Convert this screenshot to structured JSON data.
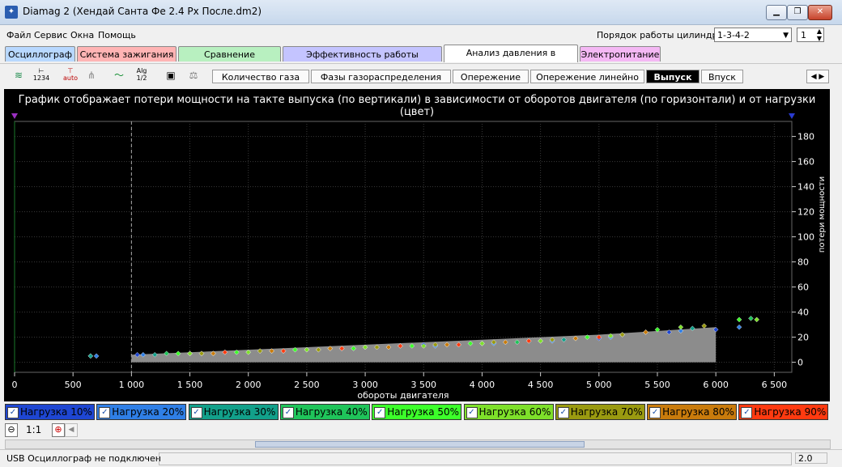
{
  "window": {
    "title": "Diamag 2 (Хендай Санта Фе 2.4 Px После.dm2)",
    "icon": "diamag-app-icon"
  },
  "menu": {
    "items": [
      "Файл",
      "Сервис",
      "Окна",
      "Помощь"
    ]
  },
  "firing_order": {
    "label": "Порядок работы цилиндров",
    "value": "1-3-4-2",
    "cylinder": "1"
  },
  "main_tabs": [
    {
      "label": "Осциллограф",
      "color": "#b8d8ff"
    },
    {
      "label": "Система зажигания",
      "color": "#ffb4b4"
    },
    {
      "label": "Сравнение цилиндров",
      "color": "#b8f0c0"
    },
    {
      "label": "Эффективность работы цилиндров",
      "color": "#c4c4ff"
    },
    {
      "label": "Анализ давления в цилиндре",
      "color": "#ffffff",
      "active": true
    },
    {
      "label": "Электропитание",
      "color": "#f4b8f4"
    }
  ],
  "toolbar": {
    "tools": [
      "waveform-icon",
      "counter-icon",
      "auto-scale-icon",
      "filter-icon",
      "curve-icon",
      "algorithm-icon",
      "save-icon",
      "balance-icon"
    ],
    "alg_top": "Alg",
    "alg_bottom": "1/2",
    "auto": "auto",
    "n1234": "1234"
  },
  "sub_tabs": [
    {
      "label": "Количество газа"
    },
    {
      "label": "Фазы газораспределения"
    },
    {
      "label": "Опережение"
    },
    {
      "label": "Опережение линейно"
    },
    {
      "label": "Выпуск",
      "active": true
    },
    {
      "label": "Впуск"
    }
  ],
  "chart_data": {
    "type": "scatter",
    "title": "График отображает потери мощности на такте выпуска (по вертикали) в зависимости от оборотов двигателя (по горизонтали) и от нагрузки (цвет)",
    "xlabel": "обороты двигателя",
    "ylabel": "потери мощности",
    "xlim": [
      0,
      6650
    ],
    "ylim": [
      -8,
      192
    ],
    "x_ticks": [
      "0",
      "500",
      "1 000",
      "1 500",
      "2 000",
      "2 500",
      "3 000",
      "3 500",
      "4 000",
      "4 500",
      "5 000",
      "5 500",
      "6 000",
      "6 500"
    ],
    "y_ticks": [
      "0",
      "20",
      "40",
      "60",
      "80",
      "100",
      "120",
      "140",
      "160",
      "180"
    ],
    "grid": true,
    "legend_position": "bottom",
    "band": {
      "x": [
        1000,
        5000,
        6000
      ],
      "y_top": [
        6,
        22,
        28
      ],
      "y_bottom": 0
    },
    "series": [
      {
        "name": "Нагрузка 10%",
        "color": "#1e46d2",
        "x": [
          650,
          1050,
          1500,
          2000,
          2500,
          3000,
          3500,
          4000,
          4500,
          5000,
          5600,
          6000
        ],
        "y": [
          5,
          6,
          7,
          8,
          10,
          12,
          14,
          15,
          17,
          19,
          24,
          26
        ]
      },
      {
        "name": "Нагрузка 20%",
        "color": "#2f7fe6",
        "x": [
          700,
          1100,
          1600,
          2100,
          2600,
          3100,
          3600,
          4100,
          4600,
          5100,
          5700,
          6200
        ],
        "y": [
          5,
          6,
          7,
          9,
          10,
          12,
          13,
          15,
          17,
          20,
          25,
          28
        ]
      },
      {
        "name": "Нагрузка 30%",
        "color": "#12a08a",
        "x": [
          650,
          1200,
          1700,
          2200,
          2700,
          3200,
          3700,
          4200,
          4700,
          5200,
          5800
        ],
        "y": [
          5,
          6,
          7,
          9,
          11,
          12,
          14,
          16,
          18,
          22,
          27
        ]
      },
      {
        "name": "Нагрузка 40%",
        "color": "#1fc45a",
        "x": [
          1300,
          1800,
          2300,
          2800,
          3300,
          3800,
          4300,
          4800,
          5400,
          6300
        ],
        "y": [
          7,
          8,
          9,
          11,
          13,
          14,
          16,
          19,
          24,
          35
        ]
      },
      {
        "name": "Нагрузка 50%",
        "color": "#3cff2a",
        "x": [
          1400,
          1900,
          2400,
          2900,
          3400,
          3900,
          4400,
          4900,
          5500,
          6200
        ],
        "y": [
          7,
          8,
          10,
          11,
          13,
          15,
          17,
          20,
          26,
          34
        ]
      },
      {
        "name": "Нагрузка 60%",
        "color": "#7ee02a",
        "x": [
          1500,
          2000,
          2500,
          3000,
          3500,
          4000,
          4500,
          5100,
          5700,
          6350
        ],
        "y": [
          7,
          8,
          10,
          12,
          13,
          15,
          17,
          21,
          28,
          34
        ]
      },
      {
        "name": "Нагрузка 70%",
        "color": "#9a9a10",
        "x": [
          1600,
          2100,
          2600,
          3100,
          3600,
          4100,
          4600,
          5200,
          5900
        ],
        "y": [
          7,
          9,
          10,
          12,
          14,
          16,
          18,
          22,
          29
        ]
      },
      {
        "name": "Нагрузка 80%",
        "color": "#c97b0c",
        "x": [
          1700,
          2200,
          2700,
          3200,
          3700,
          4200,
          4800,
          5400
        ],
        "y": [
          7,
          9,
          11,
          12,
          14,
          16,
          19,
          24
        ]
      },
      {
        "name": "Нагрузка 90%",
        "color": "#ff3a10",
        "x": [
          1800,
          2300,
          2800,
          3300,
          3800,
          4400,
          5000
        ],
        "y": [
          8,
          9,
          11,
          13,
          14,
          17,
          20
        ]
      }
    ]
  },
  "legend_check": "✓",
  "zoom": {
    "minus": "⊖",
    "ratio": "1:1",
    "plus": "⊕"
  },
  "status": {
    "text": "USB Осциллограф не подключен",
    "version": "2.0"
  }
}
